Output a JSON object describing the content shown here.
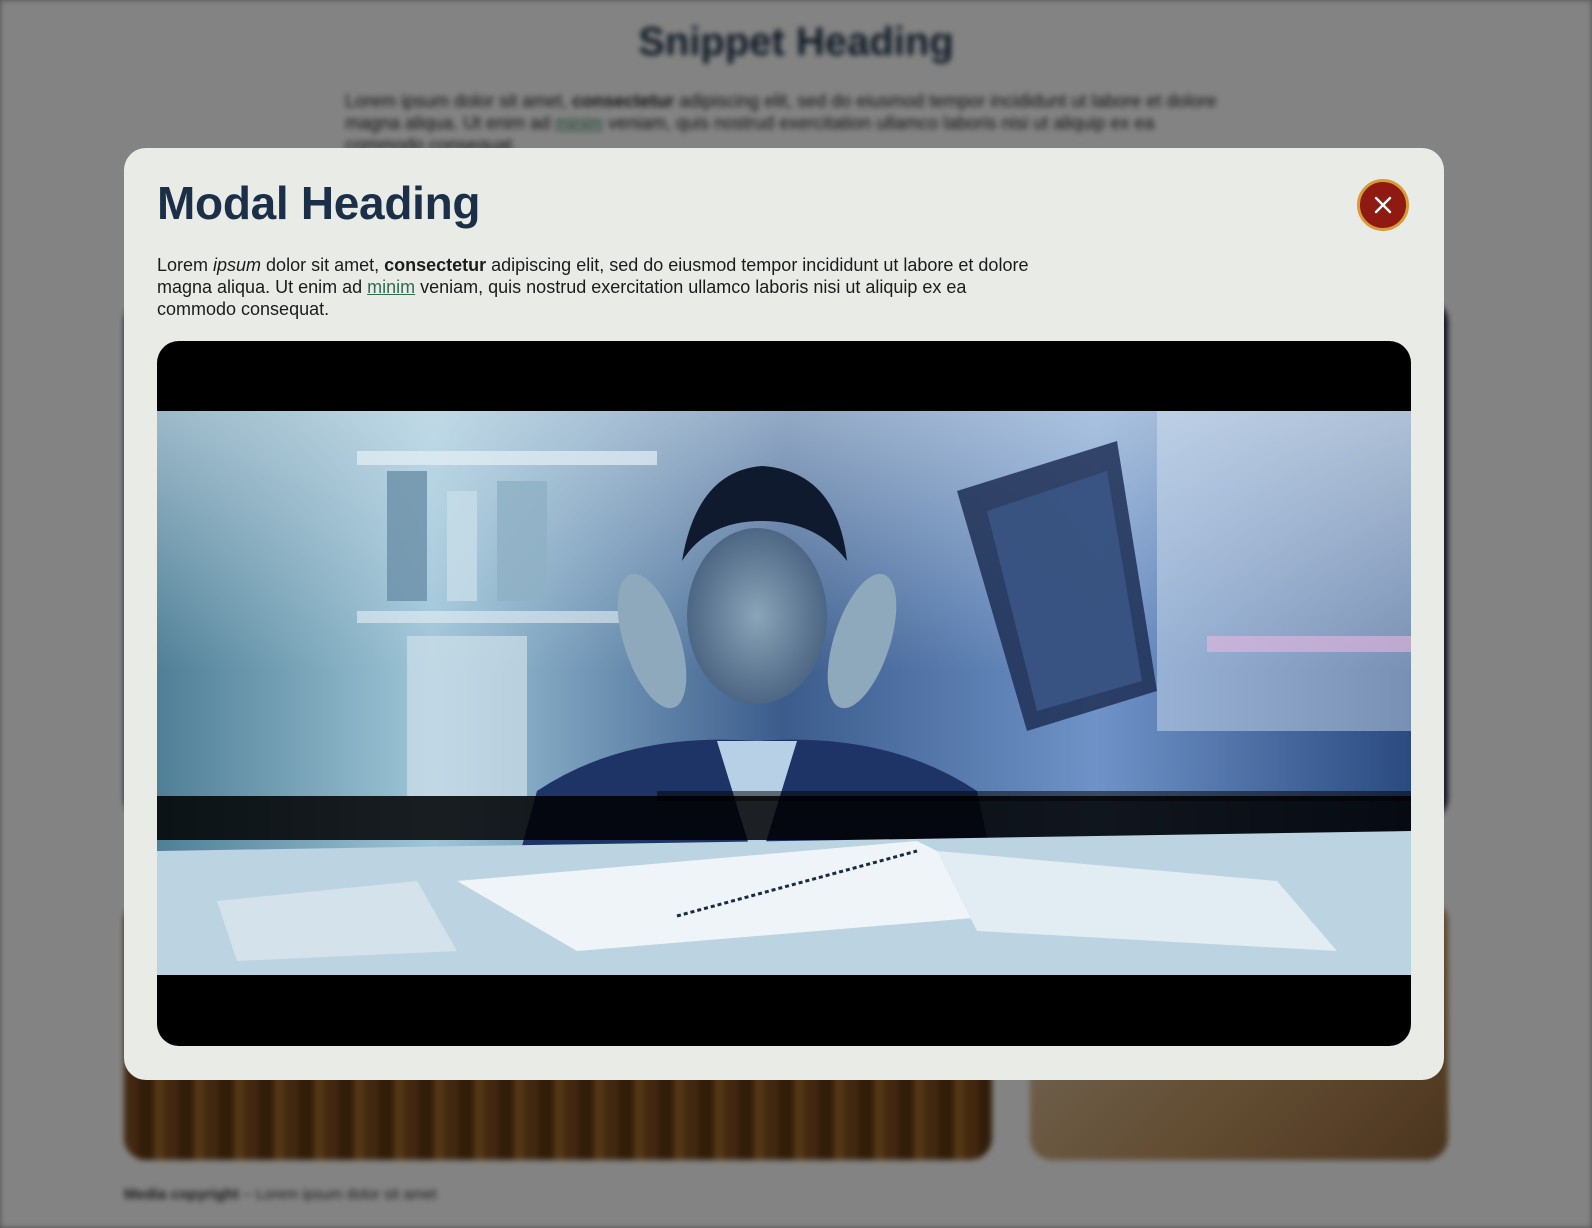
{
  "background": {
    "heading": "Snippet Heading",
    "text_parts": {
      "t1": "Lorem ipsum dolor sit amet, ",
      "b1": "consectetur",
      "t2": " adipiscing elit, sed do eiusmod tempor incididunt ut labore et dolore magna aliqua. Ut enim ad ",
      "link": "minim",
      "t3": " veniam, quis nostrud exercitation ullamco laboris nisi ut aliquip ex ea commodo consequat."
    },
    "footer_bold": "Media copyright",
    "footer_text": " – Lorem ipsum dolor sit amet"
  },
  "modal": {
    "title": "Modal Heading",
    "close_icon": "close-icon",
    "text_parts": {
      "t1": "Lorem ",
      "em1": "ipsum",
      "t2": " dolor sit amet, ",
      "b1": "consectetur",
      "t3": " adipiscing elit, sed do eiusmod tempor incididunt ut labore et dolore magna aliqua. Ut enim ad ",
      "link": "minim",
      "t4": " veniam, quis nostrud exercitation ullamco laboris nisi ut aliquip ex ea commodo consequat."
    }
  },
  "colors": {
    "modal_bg": "#e9ebe6",
    "heading": "#1b3048",
    "close_button": "#8e1a12",
    "close_button_ring": "#d99a3a",
    "link": "#2e6e4e"
  }
}
